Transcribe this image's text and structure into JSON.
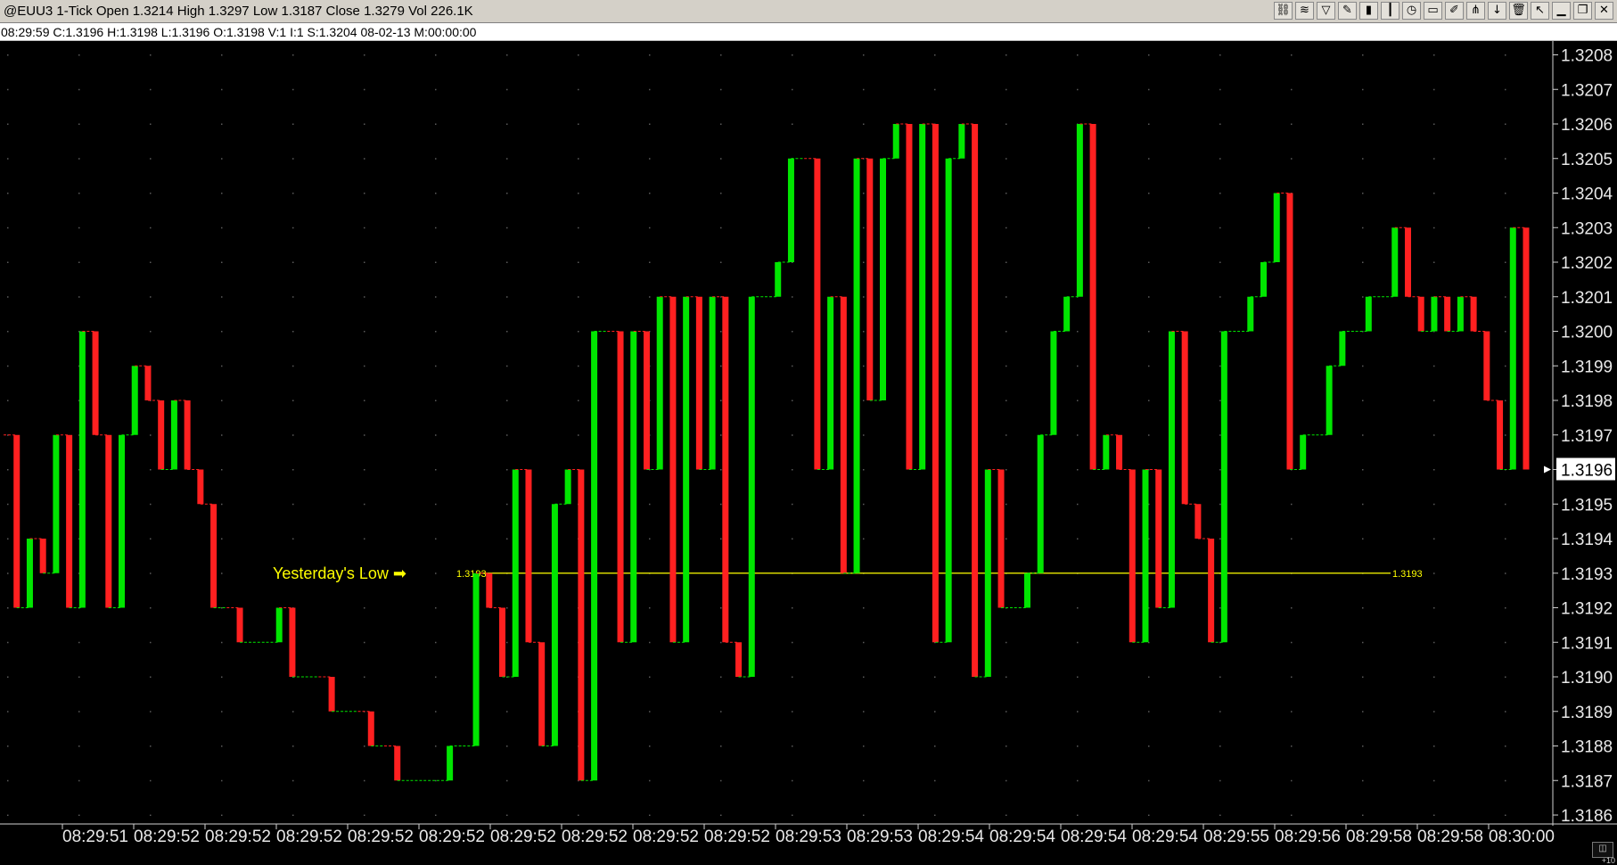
{
  "window": {
    "title": "@EUU3 1-Tick  Open 1.3214  High 1.3297  Low 1.3187  Close 1.3279  Vol 226.1K"
  },
  "infobar": {
    "text": "08:29:59  C:1.3196  H:1.3198  L:1.3196  O:1.3198  V:1  I:1  S:1.3204  08-02-13  M:00:00:00"
  },
  "toolbar": {
    "icons": [
      "link-icon",
      "bridge-icon",
      "funnel-icon",
      "pencil-icon",
      "bar-chart-icon",
      "candlestick-icon",
      "clock-icon",
      "screen-icon",
      "brush-icon",
      "fork-icon",
      "down-arrow-icon",
      "trash-icon",
      "cursor-icon",
      "minimize-icon",
      "restore-icon",
      "close-icon"
    ],
    "glyphs": [
      "⛓",
      "≋",
      "▽",
      "✎",
      "▮",
      "┃",
      "◷",
      "▭",
      "✐",
      "⋔",
      "↓",
      "🗑",
      "↖",
      "▁",
      "❐",
      "✕"
    ]
  },
  "annotation": {
    "label": "Yesterday's Low  ➡",
    "left_value": "1.3193",
    "right_value": "1.3193",
    "price": 1.3193,
    "color": "#ffff00"
  },
  "colors": {
    "up": "#00e600",
    "down": "#ff2020",
    "line": "#ffff00",
    "background": "#000000",
    "grid_dot": "#5a5a5a"
  },
  "corner": {
    "widget": "◫",
    "note": "+10"
  },
  "chart_data": {
    "type": "bar",
    "title": "@EUU3 1-Tick",
    "ylim": [
      1.3186,
      1.3208
    ],
    "y_ticks": [
      "1.3186",
      "1.3187",
      "1.3188",
      "1.3189",
      "1.3190",
      "1.3191",
      "1.3192",
      "1.3193",
      "1.3194",
      "1.3195",
      "1.3196",
      "1.3197",
      "1.3198",
      "1.3199",
      "1.3200",
      "1.3201",
      "1.3202",
      "1.3203",
      "1.3204",
      "1.3205",
      "1.3206",
      "1.3207",
      "1.3208"
    ],
    "x_ticks": [
      "08:29:51",
      "08:29:52",
      "08:29:52",
      "08:29:52",
      "08:29:52",
      "08:29:52",
      "08:29:52",
      "08:29:52",
      "08:29:52",
      "08:29:52",
      "08:29:53",
      "08:29:53",
      "08:29:54",
      "08:29:54",
      "08:29:54",
      "08:29:54",
      "08:29:55",
      "08:29:56",
      "08:29:58",
      "08:29:58",
      "08:30:00"
    ],
    "last_price": "1.3196",
    "grid": true,
    "series": [
      {
        "name": "close",
        "values": [
          1.3197,
          1.3192,
          1.3194,
          1.3193,
          1.3197,
          1.3192,
          1.32,
          1.3197,
          1.3192,
          1.3197,
          1.3199,
          1.3198,
          1.3196,
          1.3198,
          1.3196,
          1.3195,
          1.3192,
          1.3192,
          1.3191,
          1.3191,
          1.3191,
          1.3192,
          1.319,
          1.319,
          1.319,
          1.3189,
          1.3189,
          1.3189,
          1.3188,
          1.3188,
          1.3187,
          1.3187,
          1.3187,
          1.3187,
          1.3188,
          1.3188,
          1.3193,
          1.3192,
          1.319,
          1.3196,
          1.3191,
          1.3188,
          1.3195,
          1.3196,
          1.3187,
          1.32,
          1.32,
          1.3191,
          1.32,
          1.3196,
          1.3201,
          1.3191,
          1.3201,
          1.3196,
          1.3201,
          1.3191,
          1.319,
          1.3201,
          1.3201,
          1.3202,
          1.3205,
          1.3205,
          1.3196,
          1.3201,
          1.3193,
          1.3205,
          1.3198,
          1.3205,
          1.3206,
          1.3196,
          1.3206,
          1.3191,
          1.3205,
          1.3206,
          1.319,
          1.3196,
          1.3192,
          1.3192,
          1.3193,
          1.3197,
          1.32,
          1.3201,
          1.3206,
          1.3196,
          1.3197,
          1.3196,
          1.3191,
          1.3196,
          1.3192,
          1.32,
          1.3195,
          1.3194,
          1.3191,
          1.32,
          1.32,
          1.3201,
          1.3202,
          1.3204,
          1.3196,
          1.3197,
          1.3197,
          1.3199,
          1.32,
          1.32,
          1.3201,
          1.3201,
          1.3203,
          1.3201,
          1.32,
          1.3201,
          1.32,
          1.3201,
          1.32,
          1.3198,
          1.3196,
          1.3203,
          1.3196
        ]
      }
    ]
  }
}
